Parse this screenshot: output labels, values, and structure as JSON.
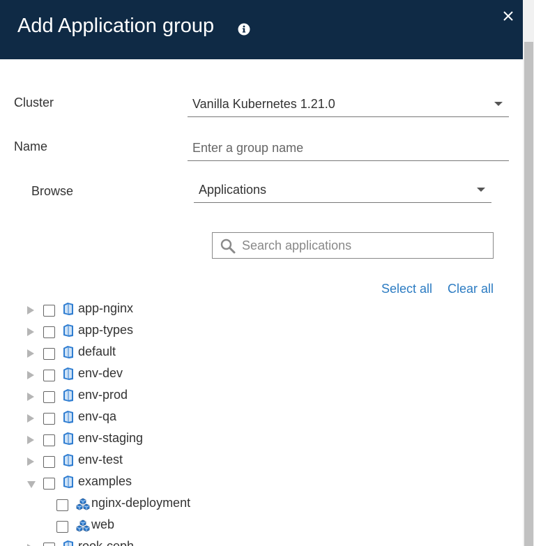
{
  "dialog": {
    "title": "Add Application group",
    "info_icon": "info-circle-icon",
    "close_icon": "close-icon"
  },
  "form": {
    "cluster_label": "Cluster",
    "cluster_value": "Vanilla Kubernetes 1.21.0",
    "name_label": "Name",
    "name_placeholder": "Enter a group name",
    "name_value": "",
    "browse_label": "Browse",
    "browse_value": "Applications"
  },
  "search": {
    "placeholder": "Search applications",
    "icon": "search-icon"
  },
  "actions": {
    "select_all": "Select all",
    "clear_all": "Clear all"
  },
  "tree": {
    "namespaces": [
      {
        "label": "app-nginx",
        "expanded": false,
        "checked": false
      },
      {
        "label": "app-types",
        "expanded": false,
        "checked": false
      },
      {
        "label": "default",
        "expanded": false,
        "checked": false
      },
      {
        "label": "env-dev",
        "expanded": false,
        "checked": false
      },
      {
        "label": "env-prod",
        "expanded": false,
        "checked": false
      },
      {
        "label": "env-qa",
        "expanded": false,
        "checked": false
      },
      {
        "label": "env-staging",
        "expanded": false,
        "checked": false
      },
      {
        "label": "env-test",
        "expanded": false,
        "checked": false
      },
      {
        "label": "examples",
        "expanded": true,
        "checked": false,
        "children": [
          {
            "label": "nginx-deployment",
            "checked": false
          },
          {
            "label": "web",
            "checked": false
          }
        ]
      },
      {
        "label": "rook-ceph",
        "expanded": false,
        "checked": false
      }
    ]
  },
  "colors": {
    "header_bg": "#0f2a45",
    "link": "#2b7bc2",
    "folder_icon": "#2f7dd1"
  }
}
